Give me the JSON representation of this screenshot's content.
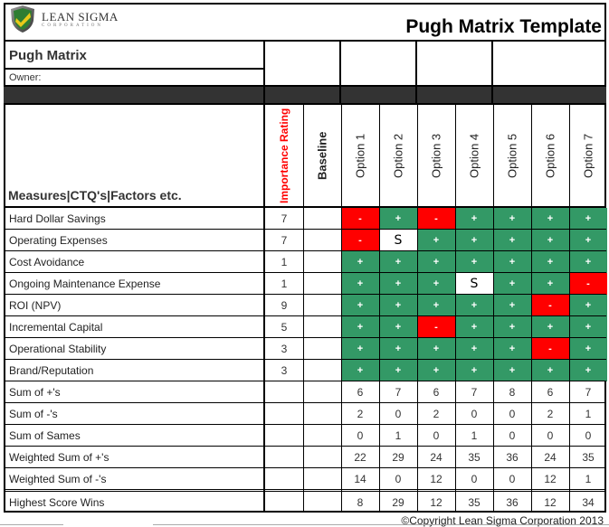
{
  "header": {
    "logo_main": "LEAN SIGMA",
    "logo_sub": "CORPORATION",
    "title": "Pugh Matrix Template"
  },
  "matrix": {
    "name": "Pugh Matrix",
    "owner_label": "Owner:",
    "measures_header": "Measures|CTQ's|Factors etc.",
    "importance_header": "Importance Rating",
    "baseline_header": "Baseline",
    "options": [
      "Option 1",
      "Option 2",
      "Option 3",
      "Option 4",
      "Option 5",
      "Option 6",
      "Option 7"
    ],
    "criteria": [
      {
        "name": "Hard Dollar Savings",
        "importance": "7",
        "ratings": [
          "-",
          "+",
          "-",
          "+",
          "+",
          "+",
          "+"
        ]
      },
      {
        "name": "Operating Expenses",
        "importance": "7",
        "ratings": [
          "-",
          "S",
          "+",
          "+",
          "+",
          "+",
          "+"
        ]
      },
      {
        "name": "Cost Avoidance",
        "importance": "1",
        "ratings": [
          "+",
          "+",
          "+",
          "+",
          "+",
          "+",
          "+"
        ]
      },
      {
        "name": "Ongoing Maintenance Expense",
        "importance": "1",
        "ratings": [
          "+",
          "+",
          "+",
          "S",
          "+",
          "+",
          "-"
        ]
      },
      {
        "name": "ROI (NPV)",
        "importance": "9",
        "ratings": [
          "+",
          "+",
          "+",
          "+",
          "+",
          "-",
          "+"
        ]
      },
      {
        "name": "Incremental Capital",
        "importance": "5",
        "ratings": [
          "+",
          "+",
          "-",
          "+",
          "+",
          "+",
          "+"
        ]
      },
      {
        "name": "Operational Stability",
        "importance": "3",
        "ratings": [
          "+",
          "+",
          "+",
          "+",
          "+",
          "-",
          "+"
        ]
      },
      {
        "name": "Brand/Reputation",
        "importance": "3",
        "ratings": [
          "+",
          "+",
          "+",
          "+",
          "+",
          "+",
          "+"
        ]
      }
    ],
    "summary": [
      {
        "name": "Sum of +'s",
        "values": [
          "6",
          "7",
          "6",
          "7",
          "8",
          "6",
          "7"
        ]
      },
      {
        "name": "Sum of  -'s",
        "values": [
          "2",
          "0",
          "2",
          "0",
          "0",
          "2",
          "1"
        ]
      },
      {
        "name": "Sum of Sames",
        "values": [
          "0",
          "1",
          "0",
          "1",
          "0",
          "0",
          "0"
        ]
      },
      {
        "name": "Weighted Sum of +'s",
        "values": [
          "22",
          "29",
          "24",
          "35",
          "36",
          "24",
          "35"
        ]
      },
      {
        "name": "Weighted Sum of  -'s",
        "values": [
          "14",
          "0",
          "12",
          "0",
          "0",
          "12",
          "1"
        ]
      }
    ],
    "final": {
      "name": "Highest Score Wins",
      "values": [
        "8",
        "29",
        "12",
        "35",
        "36",
        "12",
        "34"
      ]
    }
  },
  "colors": {
    "plus": "#339966",
    "minus": "#ff0000",
    "dark_band": "#333333",
    "importance_text": "#ff0000"
  },
  "footer": {
    "copyright": "©Copyright Lean Sigma Corporation 2013"
  }
}
